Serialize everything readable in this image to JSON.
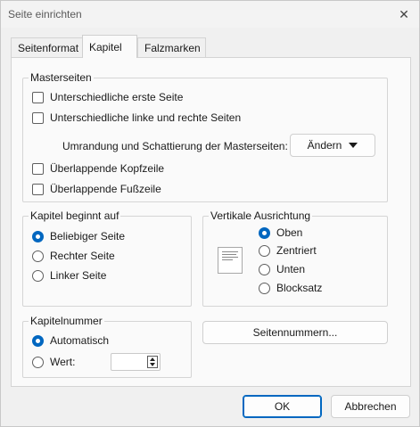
{
  "window": {
    "title": "Seite einrichten",
    "close_glyph": "✕"
  },
  "tabs": [
    {
      "label": "Seitenformat",
      "active": false
    },
    {
      "label": "Kapitel",
      "active": true
    },
    {
      "label": "Falzmarken",
      "active": false
    }
  ],
  "masterseiten": {
    "legend": "Masterseiten",
    "options": [
      {
        "label": "Unterschiedliche erste Seite",
        "checked": false
      },
      {
        "label": "Unterschiedliche linke und rechte Seiten",
        "checked": false
      },
      {
        "label": "Überlappende Kopfzeile",
        "checked": false
      },
      {
        "label": "Überlappende Fußzeile",
        "checked": false
      }
    ],
    "border_label": "Umrandung und Schattierung der Masterseiten:",
    "change_button": "Ändern"
  },
  "kapitel_beginnt": {
    "legend": "Kapitel beginnt auf",
    "options": [
      {
        "label": "Beliebiger Seite",
        "checked": true
      },
      {
        "label": "Rechter Seite",
        "checked": false
      },
      {
        "label": "Linker Seite",
        "checked": false
      }
    ]
  },
  "vertikale_ausrichtung": {
    "legend": "Vertikale Ausrichtung",
    "options": [
      {
        "label": "Oben",
        "checked": true
      },
      {
        "label": "Zentriert",
        "checked": false
      },
      {
        "label": "Unten",
        "checked": false
      },
      {
        "label": "Blocksatz",
        "checked": false
      }
    ]
  },
  "kapitelnummer": {
    "legend": "Kapitelnummer",
    "options": [
      {
        "label": "Automatisch",
        "checked": true
      },
      {
        "label": "Wert:",
        "checked": false
      }
    ],
    "value": ""
  },
  "seitennummern_button": "Seitennummern...",
  "footer": {
    "ok": "OK",
    "cancel": "Abbrechen"
  },
  "colors": {
    "accent": "#0067c0",
    "panel": "#fafafa",
    "background": "#f0f0f0"
  }
}
